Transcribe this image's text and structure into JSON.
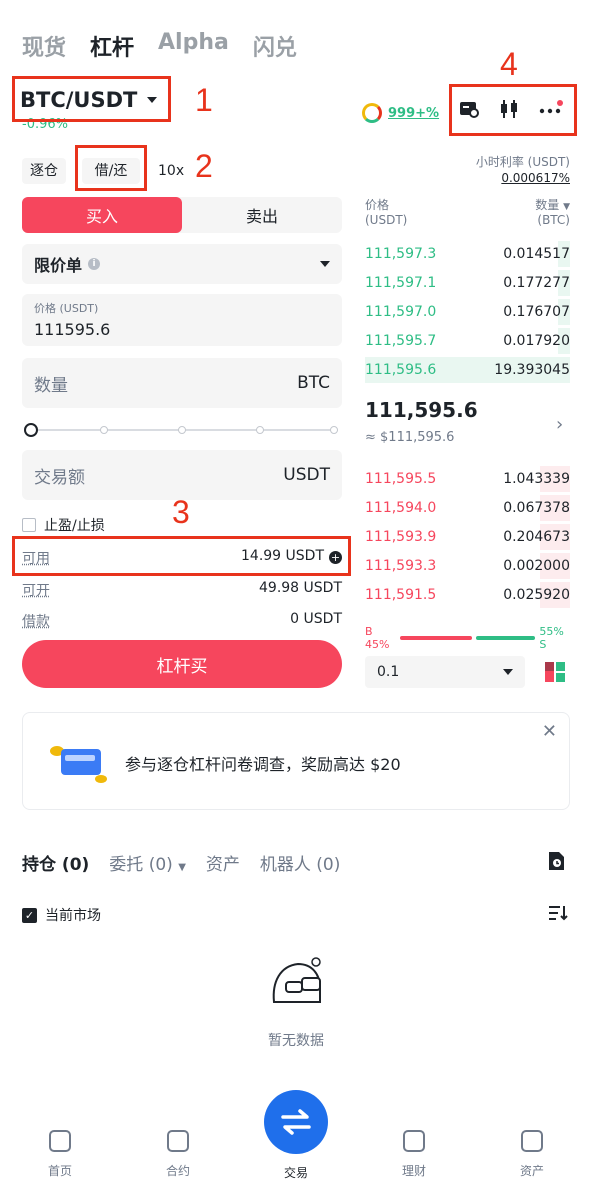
{
  "top_tabs": [
    "现货",
    "杠杆",
    "Alpha",
    "闪兑"
  ],
  "pair": {
    "name": "BTC/USDT",
    "change": "-0.96%"
  },
  "sentiment": {
    "value": "999+%"
  },
  "modes": {
    "isolated": "逐仓",
    "borrow_repay": "借/还",
    "leverage": "10x"
  },
  "hourly_rate": {
    "label": "小时利率 (USDT)",
    "value": "0.000617%"
  },
  "side": {
    "buy": "买入",
    "sell": "卖出"
  },
  "order_type": {
    "label": "限价单"
  },
  "price": {
    "label": "价格 (USDT)",
    "value": "111595.6"
  },
  "quantity": {
    "placeholder": "数量",
    "unit": "BTC"
  },
  "amount": {
    "placeholder": "交易额",
    "unit": "USDT"
  },
  "tpsl": {
    "label": "止盈/止损"
  },
  "available": {
    "label": "可用",
    "value": "14.99 USDT"
  },
  "can_open": {
    "label": "可开",
    "value": "49.98 USDT"
  },
  "loan": {
    "label": "借款",
    "value": "0 USDT"
  },
  "submit": {
    "label": "杠杆买"
  },
  "orderbook": {
    "price_header": "价格",
    "price_unit": "(USDT)",
    "qty_header": "数量",
    "qty_unit": "(BTC)",
    "asks": [
      {
        "price": "111,597.3",
        "qty": "0.014517"
      },
      {
        "price": "111,597.1",
        "qty": "0.177277"
      },
      {
        "price": "111,597.0",
        "qty": "0.176707"
      },
      {
        "price": "111,595.7",
        "qty": "0.017920"
      },
      {
        "price": "111,595.6",
        "qty": "19.393045"
      }
    ],
    "last_price": "111,595.6",
    "last_usd": "≈ $111,595.6",
    "bids": [
      {
        "price": "111,595.5",
        "qty": "1.043339"
      },
      {
        "price": "111,594.0",
        "qty": "0.067378"
      },
      {
        "price": "111,593.9",
        "qty": "0.204673"
      },
      {
        "price": "111,593.3",
        "qty": "0.002000"
      },
      {
        "price": "111,591.5",
        "qty": "0.025920"
      }
    ],
    "buy_ratio": "B 45%",
    "sell_ratio": "55% S",
    "precision": "0.1"
  },
  "banner": {
    "text": "参与逐仓杠杆问卷调查，奖励高达 $20"
  },
  "positions_tabs": {
    "holdings": "持仓 (0)",
    "orders": "委托 (0)",
    "assets": "资产",
    "bots": "机器人 (0)"
  },
  "current_market": "当前市场",
  "empty": "暂无数据",
  "nav": {
    "home": "首页",
    "futures": "合约",
    "trade": "交易",
    "earn": "理财",
    "assets": "资产"
  },
  "annotations": [
    "1",
    "2",
    "3",
    "4"
  ],
  "colors": {
    "buy": "#f6465d",
    "sell_green": "#2ebd85",
    "annotation": "#e8331c",
    "trade_button": "#1f6feb"
  }
}
